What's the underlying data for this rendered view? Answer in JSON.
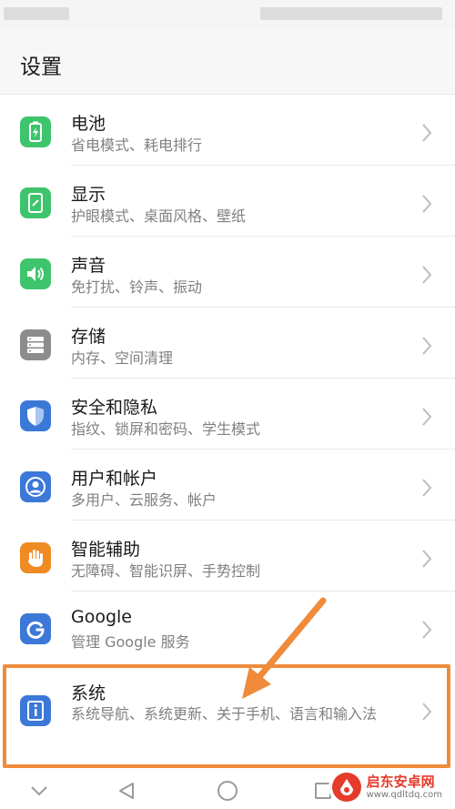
{
  "header": {
    "title": "设置"
  },
  "items": [
    {
      "key": "battery",
      "label": "电池",
      "subtitle": "省电模式、耗电排行",
      "icon": "battery-icon",
      "color": "#3ec46d"
    },
    {
      "key": "display",
      "label": "显示",
      "subtitle": "护眼模式、桌面风格、壁纸",
      "icon": "display-icon",
      "color": "#3ec46d"
    },
    {
      "key": "sound",
      "label": "声音",
      "subtitle": "免打扰、铃声、振动",
      "icon": "sound-icon",
      "color": "#3ec46d"
    },
    {
      "key": "storage",
      "label": "存储",
      "subtitle": "内存、空间清理",
      "icon": "storage-icon",
      "color": "#8c8c8c"
    },
    {
      "key": "security",
      "label": "安全和隐私",
      "subtitle": "指纹、锁屏和密码、学生模式",
      "icon": "shield-icon",
      "color": "#3b78d8"
    },
    {
      "key": "users",
      "label": "用户和帐户",
      "subtitle": "多用户、云服务、帐户",
      "icon": "user-icon",
      "color": "#3b78d8"
    },
    {
      "key": "assist",
      "label": "智能辅助",
      "subtitle": "无障碍、智能识屏、手势控制",
      "icon": "hand-icon",
      "color": "#f08a23"
    },
    {
      "key": "google",
      "label": "Google",
      "subtitle": "管理 Google 服务",
      "icon": "google-icon",
      "color": "#3b78d8"
    },
    {
      "key": "system",
      "label": "系统",
      "subtitle": "系统导航、系统更新、关于手机、语言和输入法",
      "icon": "info-icon",
      "color": "#3b78d8"
    }
  ],
  "annotation": {
    "color": "#ef8b3a"
  },
  "nav": {
    "buttons": [
      "chevron-down-icon",
      "back-icon",
      "home-icon",
      "recents-icon"
    ]
  },
  "watermark": {
    "title": "启东安卓网",
    "url": "www.qdltdq.com"
  }
}
